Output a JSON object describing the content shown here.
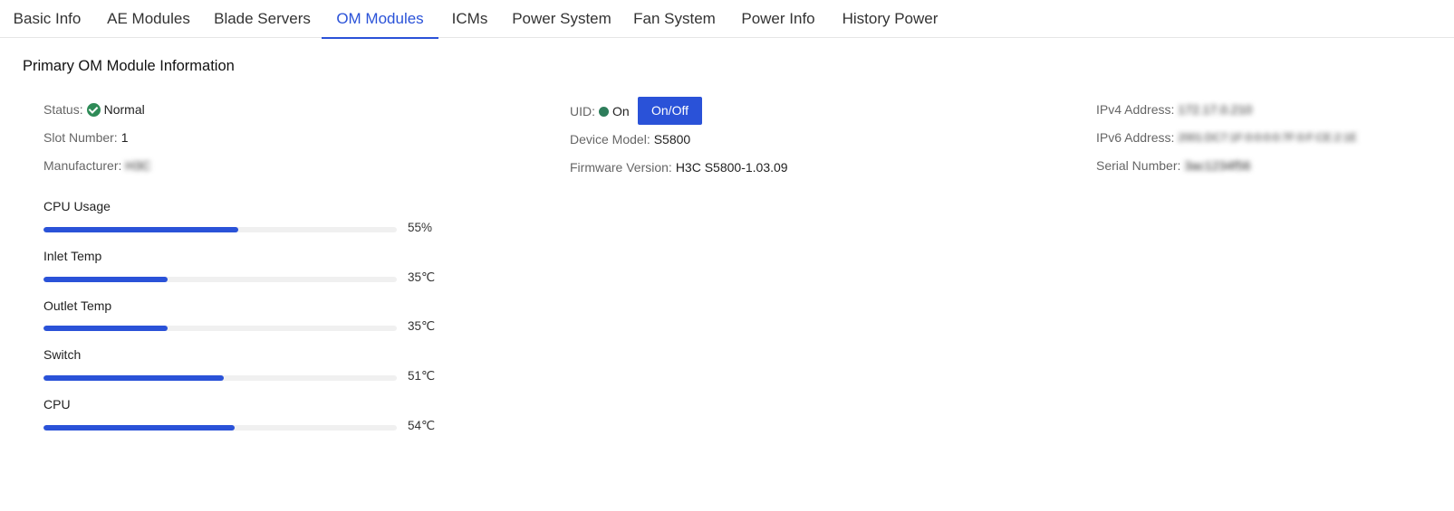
{
  "tabs": [
    {
      "label": "Basic Info",
      "active": false
    },
    {
      "label": "AE Modules",
      "active": false
    },
    {
      "label": "Blade Servers",
      "active": false
    },
    {
      "label": "OM Modules",
      "active": true
    },
    {
      "label": "ICMs",
      "active": false
    },
    {
      "label": "Power System",
      "active": false
    },
    {
      "label": "Fan System",
      "active": false
    },
    {
      "label": "Power Info",
      "active": false
    },
    {
      "label": "History Power",
      "active": false
    }
  ],
  "section": {
    "title": "Primary OM Module Information"
  },
  "info": {
    "status_label": "Status:",
    "status_value": "Normal",
    "status_icon": "check-circle-icon",
    "slot_label": "Slot Number:",
    "slot_value": "1",
    "manufacturer_label": "Manufacturer:",
    "manufacturer_value": "H3C",
    "uid_label": "UID:",
    "uid_value": "On",
    "uid_button": "On/Off",
    "model_label": "Device Model:",
    "model_value": "S5800",
    "firmware_label": "Firmware Version:",
    "firmware_value": "H3C S5800-1.03.09",
    "ipv4_label": "IPv4 Address:",
    "ipv4_value": "172.17.0.210",
    "ipv6_label": "IPv6 Address:",
    "ipv6_value": "2001:DC7:1F:0:0:0:0:7F:0:F:CE:2:1E",
    "serial_label": "Serial Number:",
    "serial_value": "3ac1234f56"
  },
  "colors": {
    "accent": "#2a52d8",
    "ok": "#2e8b57"
  },
  "metrics": [
    {
      "label": "CPU Usage",
      "value": "55%",
      "fraction": 0.55
    },
    {
      "label": "Inlet Temp",
      "value": "35℃",
      "fraction": 0.35
    },
    {
      "label": "Outlet Temp",
      "value": "35℃",
      "fraction": 0.35
    },
    {
      "label": "Switch",
      "value": "51℃",
      "fraction": 0.51
    },
    {
      "label": "CPU",
      "value": "54℃",
      "fraction": 0.54
    }
  ]
}
